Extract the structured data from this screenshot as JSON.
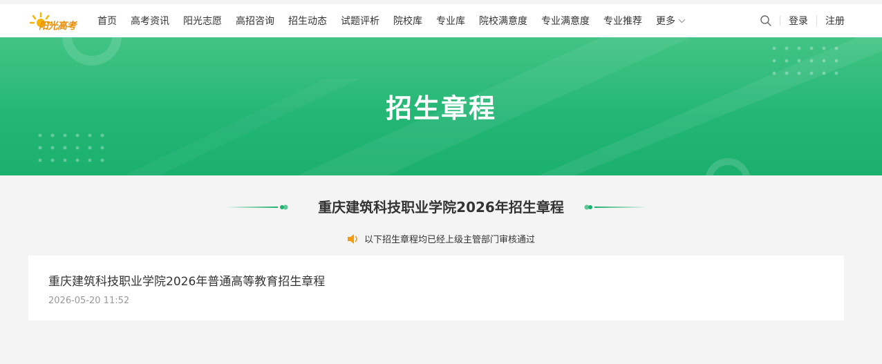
{
  "header": {
    "logo_text": "阳光高考",
    "nav": [
      "首页",
      "高考资讯",
      "阳光志愿",
      "高招咨询",
      "招生动态",
      "试题评析",
      "院校库",
      "专业库",
      "院校满意度",
      "专业满意度",
      "专业推荐"
    ],
    "more_label": "更多",
    "login_label": "登录",
    "register_label": "注册"
  },
  "banner": {
    "title": "招生章程"
  },
  "main": {
    "section_title": "重庆建筑科技职业学院2026年招生章程",
    "notice": "以下招生章程均已经上级主管部门审核通过",
    "items": [
      {
        "title": "重庆建筑科技职业学院2026年普通高等教育招生章程",
        "date": "2026-05-20 11:52"
      }
    ]
  },
  "colors": {
    "brand_green": "#1cb06e",
    "accent_orange": "#f39c12",
    "logo_orange": "#e8900a"
  }
}
